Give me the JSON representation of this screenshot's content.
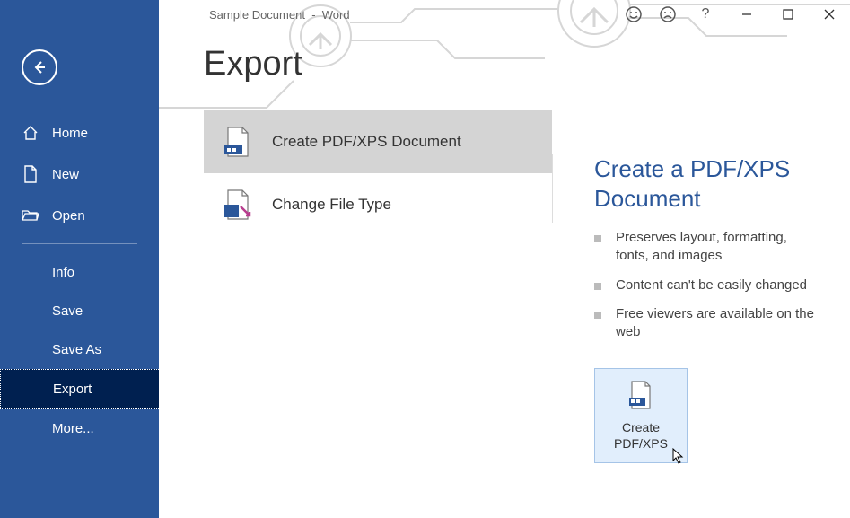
{
  "titlebar": {
    "doc_name": "Sample Document",
    "sep": "-",
    "app_name": "Word"
  },
  "page_title": "Export",
  "sidebar": {
    "home": "Home",
    "new": "New",
    "open": "Open",
    "info": "Info",
    "save": "Save",
    "save_as": "Save As",
    "export": "Export",
    "more": "More..."
  },
  "options": {
    "create_pdf": "Create PDF/XPS Document",
    "change_type": "Change File Type"
  },
  "detail": {
    "title": "Create a PDF/XPS Document",
    "bullets": [
      "Preserves layout, formatting, fonts, and images",
      "Content can't be easily changed",
      "Free viewers are available on the web"
    ],
    "button_line1": "Create",
    "button_line2": "PDF/XPS"
  }
}
